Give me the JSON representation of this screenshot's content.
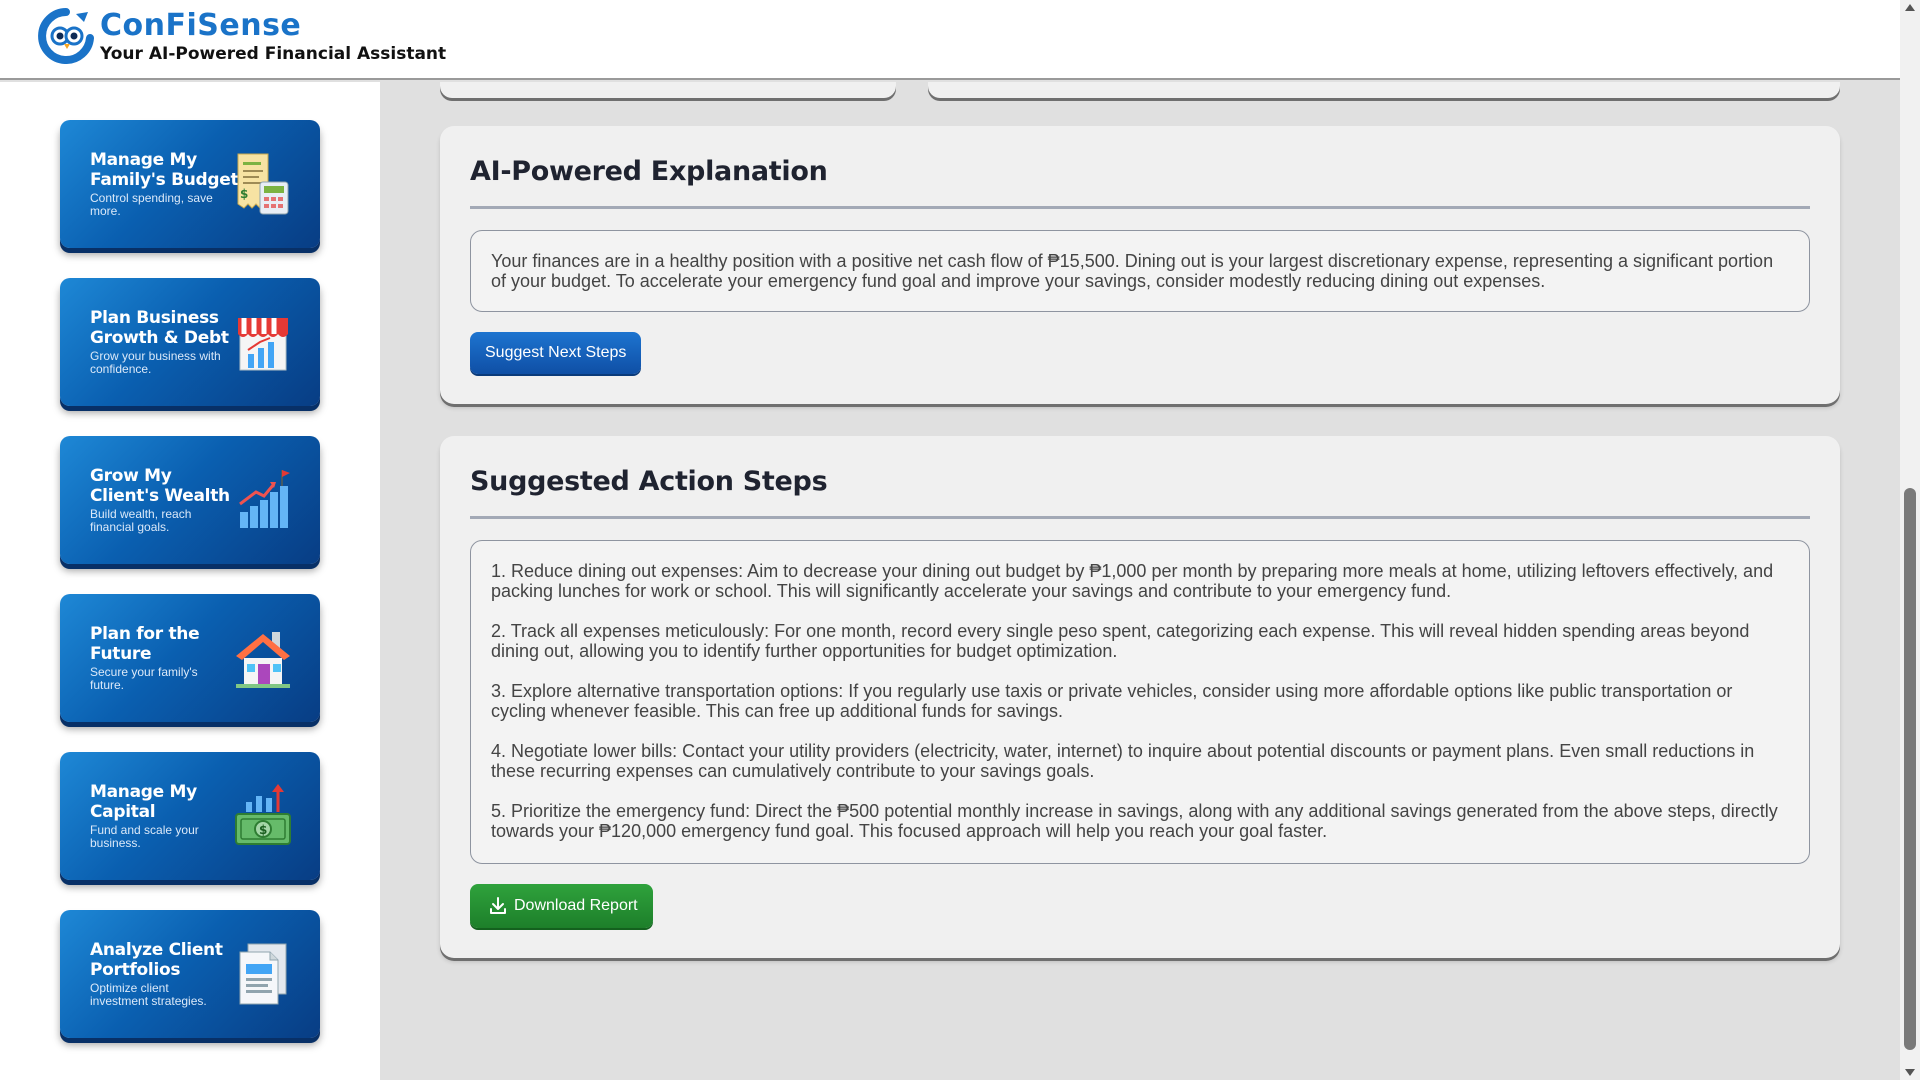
{
  "header": {
    "brand_name": "ConFiSense",
    "tagline": "Your AI-Powered Financial Assistant",
    "logo_icon": "owl-logo-icon"
  },
  "sidebar": {
    "cards": [
      {
        "title": "Manage My Family's Budget",
        "subtitle": "Control spending, save more.",
        "icon": "budget-receipt-calculator-icon"
      },
      {
        "title": "Plan Business Growth & Debt",
        "subtitle": "Grow your business with confidence.",
        "icon": "storefront-growth-icon"
      },
      {
        "title": "Grow My Client's Wealth",
        "subtitle": "Build wealth, reach financial goals.",
        "icon": "growth-chart-flag-icon"
      },
      {
        "title": "Plan for the Future",
        "subtitle": "Secure your family's future.",
        "icon": "house-icon"
      },
      {
        "title": "Manage My Capital",
        "subtitle": "Fund and scale your business.",
        "icon": "money-chart-icon"
      },
      {
        "title": "Analyze Client Portfolios",
        "subtitle": "Optimize client investment strategies.",
        "icon": "document-report-icon"
      }
    ]
  },
  "explanation": {
    "title": "AI-Powered Explanation",
    "text": "Your finances are in a healthy position with a positive net cash flow of ₱15,500. Dining out is your largest discretionary expense, representing a significant portion of your budget. To accelerate your emergency fund goal and improve your savings, consider modestly reducing dining out expenses.",
    "button_label": "Suggest Next Steps"
  },
  "actions": {
    "title": "Suggested Action Steps",
    "steps": [
      "1. Reduce dining out expenses: Aim to decrease your dining out budget by ₱1,000 per month by preparing more meals at home, utilizing leftovers effectively, and packing lunches for work or school. This will significantly accelerate your savings and contribute to your emergency fund.",
      "2. Track all expenses meticulously: For one month, record every single peso spent, categorizing each expense. This will reveal hidden spending areas beyond dining out, allowing you to identify further opportunities for budget optimization.",
      "3. Explore alternative transportation options: If you regularly use taxis or private vehicles, consider using more affordable options like public transportation or cycling whenever feasible. This can free up additional funds for savings.",
      "4. Negotiate lower bills: Contact your utility providers (electricity, water, internet) to inquire about potential discounts or payment plans. Even small reductions in these recurring expenses can cumulatively contribute to your savings goals.",
      "5. Prioritize the emergency fund: Direct the ₱500 potential monthly increase in savings, along with any additional savings generated from the above steps, directly towards your ₱120,000 emergency fund goal. This focused approach will help you reach your goal faster."
    ],
    "download_label": "Download Report",
    "download_icon": "download-icon"
  },
  "colors": {
    "brand_blue": "#1a73c8",
    "card_gradient_start": "#1e88d6",
    "card_gradient_end": "#083d84",
    "primary_button": "#1565c0",
    "success_button": "#2e9a3a",
    "panel_bg": "#f0f0f0",
    "page_bg": "#e0e0e0"
  }
}
